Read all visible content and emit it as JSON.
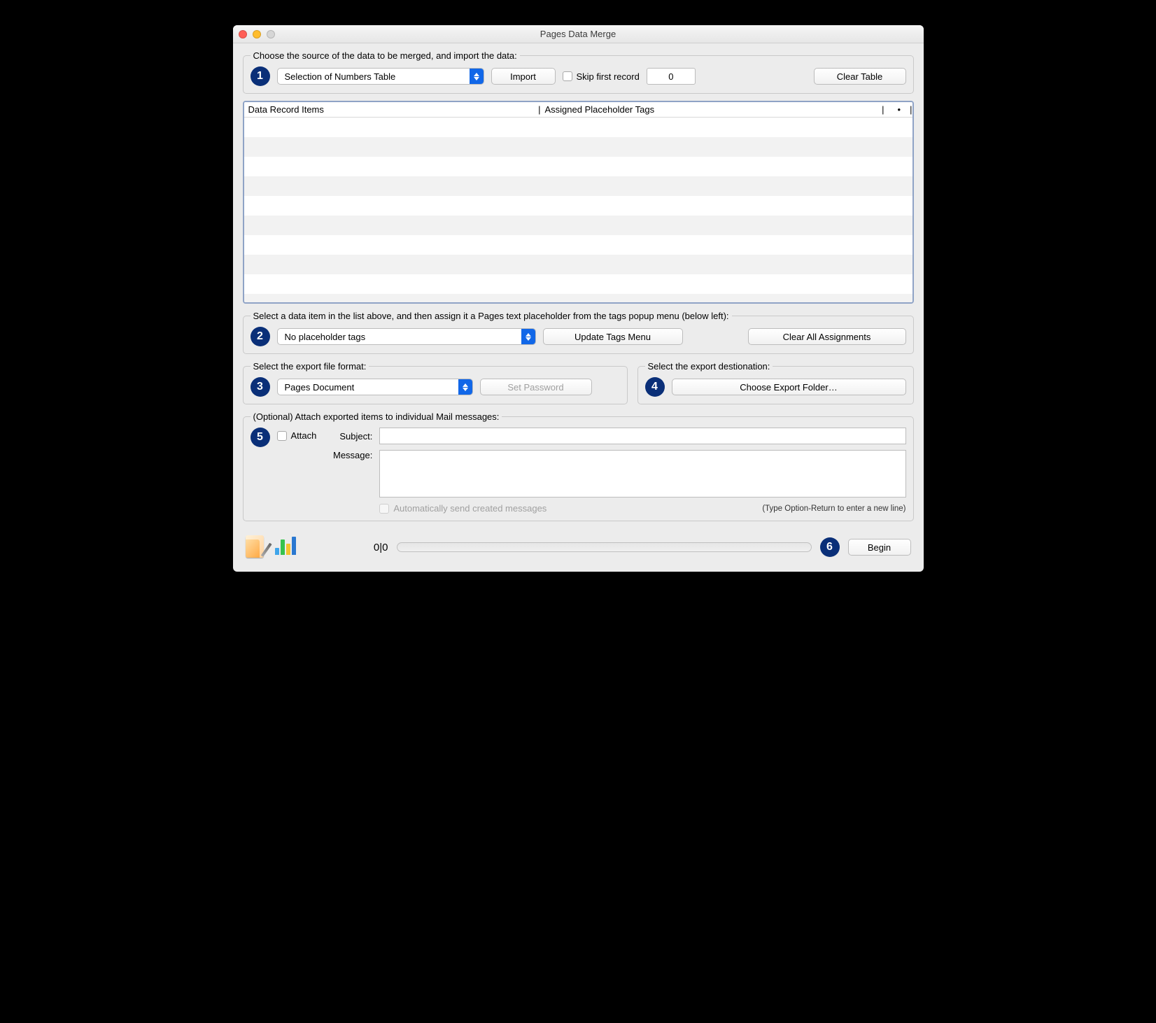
{
  "window": {
    "title": "Pages Data Merge"
  },
  "step1": {
    "legend": "Choose the source of the data to be merged, and import the data:",
    "source_select": "Selection of Numbers Table",
    "import_btn": "Import",
    "skip_label": "Skip first record",
    "skip_value": "0",
    "clear_btn": "Clear Table"
  },
  "table": {
    "col1": "Data Record Items",
    "col2": "Assigned Placeholder Tags",
    "col3_dot": "•",
    "divider": "|"
  },
  "step2": {
    "legend": "Select a data item in the list above, and then assign it a Pages text placeholder from the tags popup menu (below left):",
    "tags_select": "No placeholder tags",
    "update_btn": "Update Tags Menu",
    "clear_btn": "Clear All Assignments"
  },
  "step3": {
    "legend": "Select the export file format:",
    "format_select": "Pages Document",
    "password_btn": "Set Password"
  },
  "step4": {
    "legend": "Select the export destionation:",
    "choose_btn": "Choose Export Folder…"
  },
  "step5": {
    "legend": "(Optional) Attach exported items to individual Mail messages:",
    "attach_label": "Attach",
    "subject_label": "Subject:",
    "subject_value": "",
    "message_label": "Message:",
    "message_value": "",
    "auto_send_label": "Automatically send created messages",
    "hint": "(Type Option-Return to enter a new line)"
  },
  "footer": {
    "counter": "0|0",
    "begin_btn": "Begin"
  }
}
